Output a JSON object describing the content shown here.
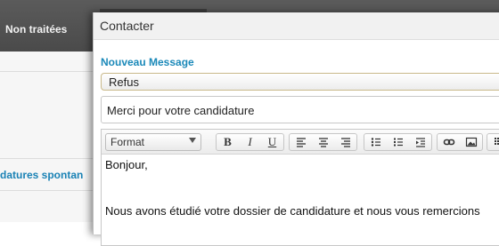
{
  "background": {
    "tab_label": "Non traitées",
    "section_label": "datures spontan"
  },
  "modal": {
    "title": "Contacter",
    "section_label": "Nouveau Message",
    "template_select": {
      "value": "Refus"
    },
    "subject_input": {
      "value": "Merci pour votre candidature"
    },
    "editor": {
      "format_label": "Format",
      "bold": "B",
      "italic": "I",
      "underline": "U",
      "body_line_1": "Bonjour,",
      "body_line_2": "Nous avons étudié votre dossier de candidature et nous vous remercions"
    }
  }
}
